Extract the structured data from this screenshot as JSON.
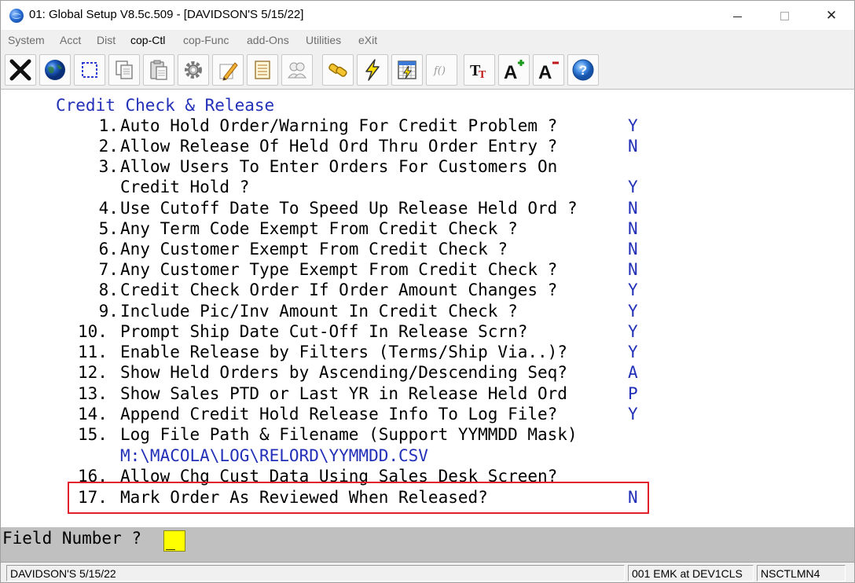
{
  "window": {
    "title": "01: Global Setup V8.5c.509 - [DAVIDSON'S 5/15/22]",
    "minimize_glyph": "",
    "maximize_glyph": "",
    "close_glyph": "✕"
  },
  "menu": {
    "items": [
      {
        "label": "System"
      },
      {
        "label": "Acct"
      },
      {
        "label": "Dist"
      },
      {
        "label": "cop-Ctl"
      },
      {
        "label": "cop-Func"
      },
      {
        "label": "add-Ons"
      },
      {
        "label": "Utilities"
      },
      {
        "label": "eXit"
      }
    ]
  },
  "toolbar": {
    "buttons": [
      {
        "icon": "close-x-icon"
      },
      {
        "icon": "globe-icon"
      },
      {
        "icon": "select-box-icon"
      },
      {
        "icon": "copy-icon"
      },
      {
        "icon": "paste-icon"
      },
      {
        "icon": "settings-icon"
      },
      {
        "icon": "edit-pencil-icon"
      },
      {
        "icon": "notepad-icon"
      },
      {
        "icon": "users-icon"
      },
      {
        "icon": "link-icon"
      },
      {
        "icon": "lightning-icon"
      },
      {
        "icon": "calculator-flash-icon"
      },
      {
        "icon": "function-icon"
      },
      {
        "icon": "font-icon"
      },
      {
        "icon": "font-increase-icon"
      },
      {
        "icon": "font-decrease-icon"
      },
      {
        "icon": "help-icon"
      }
    ],
    "font_label": "TT",
    "font_up_label": "A",
    "font_down_label": "A",
    "function_label": "f()",
    "help_label": "?"
  },
  "screen": {
    "heading": "Credit Check & Release",
    "questions": [
      {
        "num": " 1.",
        "text": "Auto Hold Order/Warning For Credit Problem ?",
        "answer": "Y"
      },
      {
        "num": " 2.",
        "text": "Allow Release Of Held Ord Thru Order Entry ?",
        "answer": "N"
      },
      {
        "num": " 3.",
        "text": "Allow Users To Enter Orders For Customers On",
        "answer": ""
      },
      {
        "num": "",
        "text": "Credit Hold ?",
        "answer": "Y"
      },
      {
        "num": " 4.",
        "text": "Use Cutoff Date To Speed Up Release Held Ord ?",
        "answer": "N"
      },
      {
        "num": " 5.",
        "text": "Any Term Code Exempt From Credit Check ?",
        "answer": "N"
      },
      {
        "num": " 6.",
        "text": "Any Customer Exempt From Credit Check ?",
        "answer": "N"
      },
      {
        "num": " 7.",
        "text": "Any Customer Type Exempt From Credit Check ?",
        "answer": "N"
      },
      {
        "num": " 8.",
        "text": "Credit Check Order If Order Amount Changes ?",
        "answer": "Y"
      },
      {
        "num": " 9.",
        "text": "Include Pic/Inv Amount In Credit Check ?",
        "answer": "Y"
      },
      {
        "num": "10.",
        "text": "Prompt Ship Date Cut-Off In Release Scrn?",
        "answer": "Y"
      },
      {
        "num": "11.",
        "text": "Enable Release by Filters (Terms/Ship Via..)?",
        "answer": "Y"
      },
      {
        "num": "12.",
        "text": "Show Held Orders by Ascending/Descending Seq?",
        "answer": "A"
      },
      {
        "num": "13.",
        "text": "Show Sales PTD or Last YR in Release Held Ord",
        "answer": "P"
      },
      {
        "num": "14.",
        "text": "Append Credit Hold Release Info To Log File?",
        "answer": "Y"
      },
      {
        "num": "15.",
        "text": "Log File Path & Filename (Support YYMMDD Mask)",
        "answer": ""
      },
      {
        "num": "16.",
        "text": "Allow Chg Cust Data Using Sales Desk Screen?",
        "answer": ""
      },
      {
        "num": "17.",
        "text": "Mark Order As Reviewed When Released?",
        "answer": "N"
      }
    ],
    "log_path": "M:\\MACOLA\\LOG\\RELORD\\YYMMDD.CSV"
  },
  "prompt": {
    "label": "Field Number ?",
    "value": "_"
  },
  "status": {
    "company": "DAVIDSON'S 5/15/22",
    "user": "001 EMK at DEV1CLS",
    "terminal": "NSCTLMN4"
  },
  "colors": {
    "screen_text_blue": "#2230b8",
    "highlight_red": "#e0202a",
    "prompt_bar": "#c0c0c0",
    "input_yellow": "#ffff00"
  }
}
